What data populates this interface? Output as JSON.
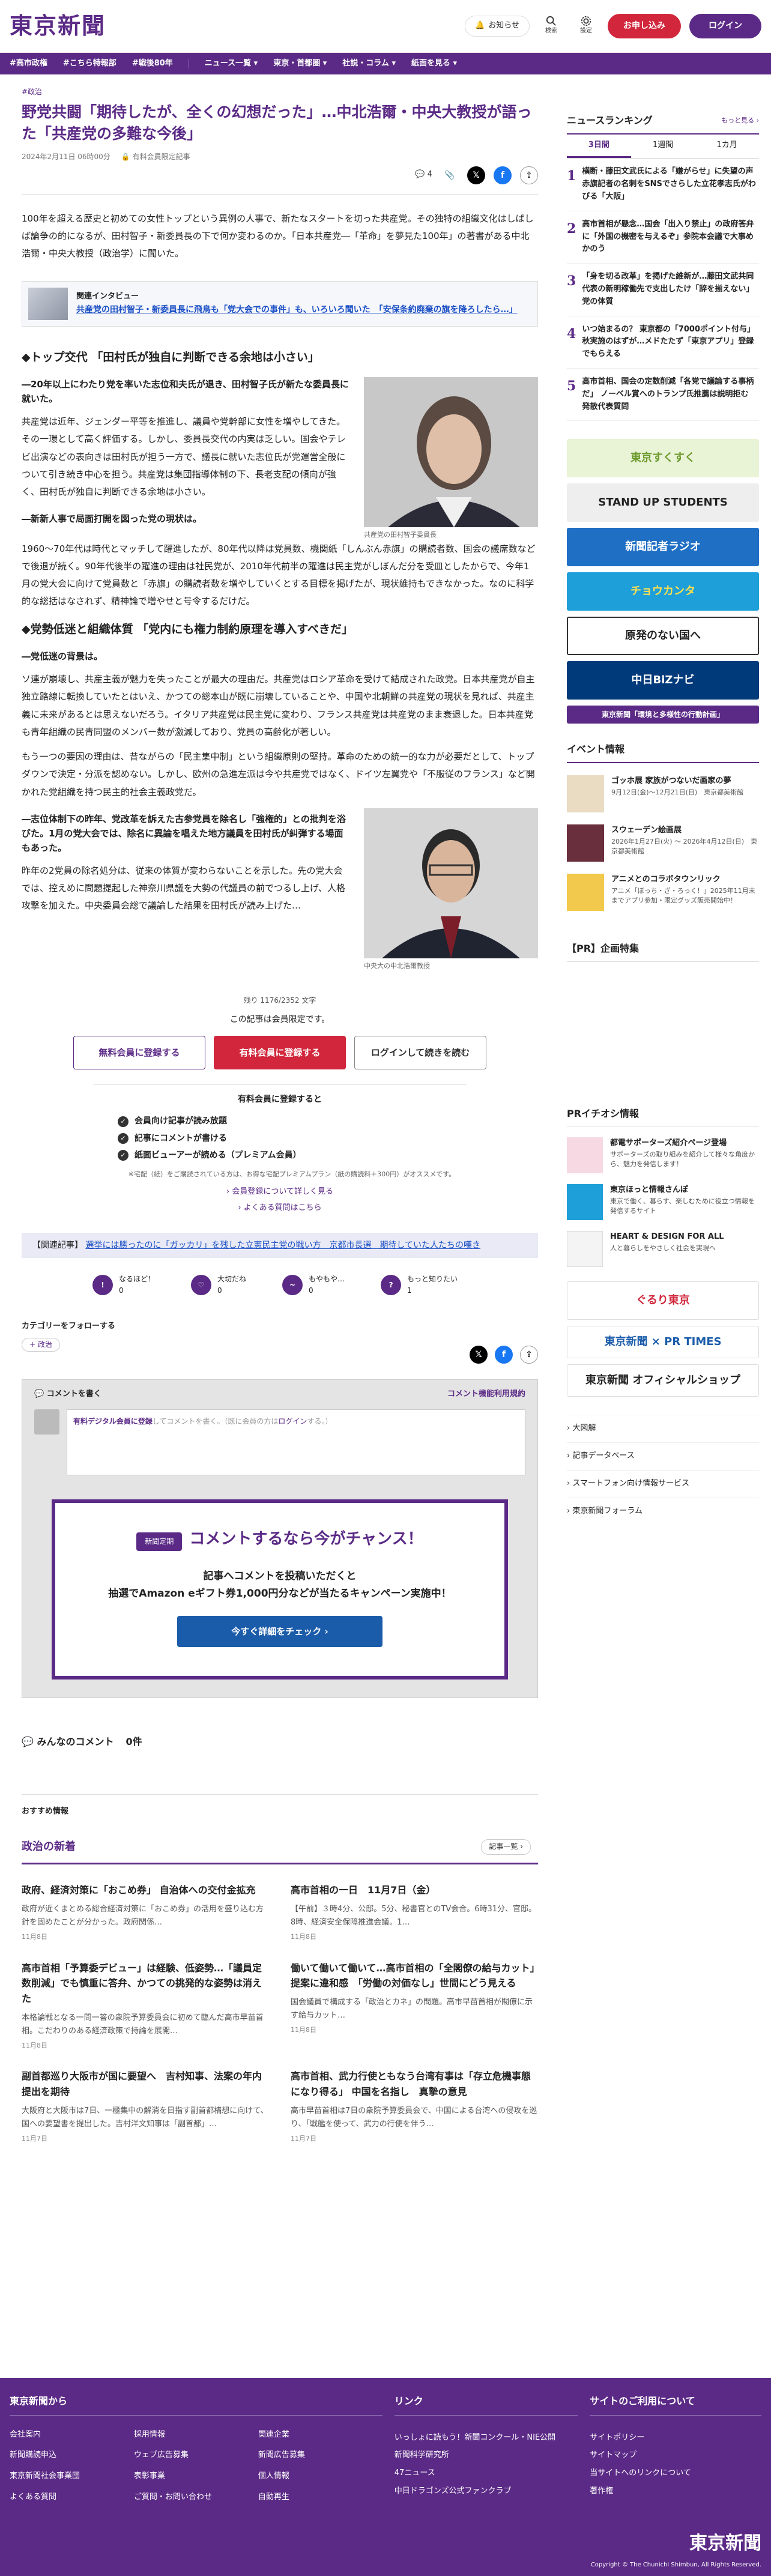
{
  "header": {
    "logo": "東京新聞",
    "notify_label": "お知らせ",
    "search_label": "検索",
    "settings_label": "設定",
    "signup_label": "お申し込み",
    "login_label": "ログイン"
  },
  "nav": [
    "#高市政権",
    "#こちら特報部",
    "#戦後80年",
    "ニュース一覧",
    "東京・首都圏",
    "社説・コラム",
    "紙面を見る"
  ],
  "article": {
    "category": "#政治",
    "title": "野党共闘「期待したが、全くの幻想だった」…中北浩爾・中央大教授が語った「共産党の多難な今後」",
    "date": "2024年2月11日 06時00分",
    "members_badge": "有料会員限定記事",
    "share_count": "4",
    "lead": "100年を超える歴史と初めての女性トップという異例の人事で、新たなスタートを切った共産党。その独特の組織文化はしばしば論争の的になるが、田村智子・新委員長の下で何か変わるのか。「日本共産党―「革命」を夢見た100年」の著書がある中北浩爾・中央大教授（政治学）に聞いた。",
    "related_label": "関連インタビュー",
    "related_link": "共産党の田村智子・新委員長に飛鳥も「党大会での事件」も、いろいろ聞いた　「安保条約廃棄の旗を降ろしたら…」",
    "sec1_title": "◆トップ交代 「田村氏が独自に判断できる余地は小さい」",
    "q1": "―20年以上にわたり党を率いた志位和夫氏が退き、田村智子氏が新たな委員長に就いた。",
    "p1": "共産党は近年、ジェンダー平等を推進し、議員や党幹部に女性を増やしてきた。その一環として高く評価する。しかし、委員長交代の内実は乏しい。国会やテレビ出演などの表向きは田村氏が担う一方で、議長に就いた志位氏が党運営全般について引き続き中心を担う。共産党は集団指導体制の下、長老支配の傾向が強く、田村氏が独自に判断できる余地は小さい。",
    "photo1_caption": "共産党の田村智子委員長",
    "q2": "―新新人事で局面打開を図った党の現状は。",
    "p2": "1960〜70年代は時代とマッチして躍進したが、80年代以降は党員数、機関紙「しんぶん赤旗」の購読者数、国会の議席数などで後退が続く。90年代後半の躍進の理由は社民党が、2010年代前半の躍進は民主党がしぼんだ分を受皿としたからで、今年1月の党大会に向けて党員数と「赤旗」の購読者数を増やしていくとする目標を掲げたが、現状維持もできなかった。なのに科学的な総括はなされず、精神論で増やせと号令するだけだ。",
    "sec2_title": "◆党勢低迷と組織体質 「党内にも権力制約原理を導入すべきだ」",
    "q3": "―党低迷の背景は。",
    "p3": "ソ連が崩壊し、共産主義が魅力を失ったことが最大の理由だ。共産党はロシア革命を受けて結成された政党。日本共産党が自主独立路線に転換していたとはいえ、かつての総本山が既に崩壊していることや、中国や北朝鮮の共産党の現状を見れば、共産主義に未来があるとは思えないだろう。イタリア共産党は民主党に変わり、フランス共産党は共産党のまま衰退した。日本共産党も青年組織の民青同盟のメンバー数が激減しており、党員の高齢化が著しい。",
    "p4": "もう一つの要因の理由は、昔ながらの「民主集中制」という組織原則の堅持。革命のための統一的な力が必要だとして、トップダウンで決定・分派を認めない。しかし、欧州の急進左派は今や共産党ではなく、ドイツ左翼党や「不服従のフランス」など開かれた党組織を持つ民主的社会主義政党だ。",
    "q4": "―志位体制下の昨年、党改革を訴えた古参党員を除名し「強権的」との批判を浴びた。1月の党大会では、除名に異論を唱えた地方議員を田村氏が糾弾する場面もあった。",
    "p5": "昨年の2党員の除名処分は、従来の体質が変わらないことを示した。先の党大会では、控えめに問題提起した神奈川県議を大勢の代議員の前でつるし上げ、人格攻撃を加えた。中央委員会総で議論した結果を田村氏が読み上げた…",
    "photo2_caption": "中央大の中北浩爾教授"
  },
  "paywall": {
    "remaining": "残り 1176/2352 文字",
    "message": "この記事は会員限定です。",
    "free_btn": "無料会員に登録する",
    "paid_btn": "有料会員に登録する",
    "login_btn": "ログインして続きを読む",
    "benefit_head": "有料会員に登録すると",
    "benefits": [
      "会員向け記事が読み放題",
      "記事にコメントが書ける",
      "紙面ビューアーが読める（プレミアム会員）"
    ],
    "note": "※宅配（紙）をご購読されている方は、お得な宅配プレミアムプラン（紙の購読料＋300円）がオススメです。",
    "link1": "会員登録について詳しく見る",
    "link2": "よくある質問はこちら"
  },
  "related_bar": {
    "label": "【関連記事】",
    "link": "選挙には勝ったのに「ガッカリ」を残した立憲民主党の戦い方　京都市長選　期待していた人たちの嘆き"
  },
  "reactions": [
    {
      "label": "なるほど！",
      "count": "0"
    },
    {
      "label": "大切だね",
      "count": "0"
    },
    {
      "label": "もやもや…",
      "count": "0"
    },
    {
      "label": "もっと知りたい",
      "count": "1"
    }
  ],
  "follow": {
    "label": "カテゴリーをフォローする",
    "tag": "政治"
  },
  "comment": {
    "head": "コメントを書く",
    "policy": "コメント機能利用規約",
    "login_prompt_pre": "有料デジタル会員に登録",
    "login_prompt_mid": "してコメントを書く。（既に会員の方は",
    "login_prompt_login": "ログイン",
    "login_prompt_post": "する。）"
  },
  "promo": {
    "tag": "新聞定期",
    "title": "コメントするなら今がチャンス！",
    "body1": "記事へコメントを投稿いただくと",
    "body2": "抽選でAmazon eギフト券1,000円分などが当たるキャンペーン実施中！",
    "btn": "今すぐ詳細をチェック"
  },
  "comments_count": {
    "label": "みんなのコメント",
    "count": "0件"
  },
  "recommend_label": "おすすめ情報",
  "politics_news": {
    "title": "政治の新着",
    "more": "記事一覧",
    "items": [
      {
        "title": "政府、経済対策に「おこめ券」 自治体への交付金拡充",
        "summary": "政府が近くまとめる総合経済対策に「おこめ券」の活用を盛り込む方針を固めたことが分かった。政府関係…",
        "date": "11月8日"
      },
      {
        "title": "高市首相の一日　11月7日（金）",
        "summary": "【午前】３時4分、公邸。5分、秘書官とのTV会合。6時31分、官邸。8時、経済安全保障推進会議。1…",
        "date": "11月8日"
      },
      {
        "title": "高市首相「予算委デビュー」は経験、低姿勢…「議員定数削減」でも慎重に答弁、かつての挑発的な姿勢は消えた",
        "summary": "本格論戦となる一問一答の衆院予算委員会に初めて臨んだ高市早苗首相。こだわりのある経済政策で持論を展開…",
        "date": "11月8日"
      },
      {
        "title": "働いて働いて働いて…高市首相の「全閣僚の給与カット」提案に違和感　「労働の対価なし」世間にどう見える",
        "summary": "国会議員で構成する「政治とカネ」の問題。高市早苗首相が閣僚に示す給与カット…",
        "date": "11月8日"
      },
      {
        "title": "副首都巡り大阪市が国に要望へ　吉村知事、法案の年内提出を期待",
        "summary": "大阪府と大阪市は7日、一極集中の解消を目指す副首都構想に向けて、国への要望書を提出した。吉村洋文知事は「副首都」…",
        "date": "11月7日"
      },
      {
        "title": "高市首相、武力行使ともなう台湾有事は「存立危機事態になり得る」 中国を名指し　真摯の意見",
        "summary": "高市早苗首相は7日の衆院予算委員会で、中国による台湾への侵攻を巡り、「戦艦を使って、武力の行使を伴う…",
        "date": "11月7日"
      }
    ]
  },
  "sidebar": {
    "ranking_title": "ニュースランキング",
    "ranking_more": "もっと見る",
    "tabs": [
      "3日間",
      "1週間",
      "1カ月"
    ],
    "ranking": [
      {
        "n": "1",
        "t": "横断・藤田文武氏による「嫌がらせ」に失望の声　赤旗記者の名刺をSNSでさらした立花孝志氏がわびる「大阪」"
      },
      {
        "n": "2",
        "t": "高市首相が懸念…国会「出入り禁止」の政府答弁に「外国の機密を与えるぞ」参院本会議で大事めかのう"
      },
      {
        "n": "3",
        "t": "「身を切る改革」を掲げた維新が…藤田文武共同代表の新明稼働先で支出したけ「辞を揃えない」党の体質"
      },
      {
        "n": "4",
        "t": "いつ始まるの？ 東京都の「7000ポイント付与」 秋実施のはずが…メドたたず「東京アプリ」登録でもらえる"
      },
      {
        "n": "5",
        "t": "高市首相、国会の定数削減「各党で議論する事柄だ」 ノーベル賞へのトランプ氏推薦は説明拒む　発散代表質問"
      }
    ],
    "banners": [
      "東京すくすく",
      "STAND UP STUDENTS",
      "新聞記者ラジオ",
      "チョウカンタ",
      "原発のない国へ",
      "中日BiZナビ",
      "東京新聞「環境と多様性の行動計画」"
    ],
    "events_title": "イベント情報",
    "events": [
      {
        "t": "ゴッホ展 家族がつないだ画家の夢",
        "s": "9月12日(金)〜12月21日(日)　東京都美術館"
      },
      {
        "t": "スウェーデン絵画展",
        "s": "2026年1月27日(火) 〜 2026年4月12日(日)　東京都美術館"
      },
      {
        "t": "アニメとのコラボタウンリック",
        "s": "アニメ「ぼっち・ざ・ろっく！」2025年11月末までアプリ参加・限定グッズ販売開始中！"
      }
    ],
    "pr_title": "【PR】企画特集",
    "pr2_title": "PRイチオシ情報",
    "pr2": [
      {
        "t": "都電サポーターズ紹介ページ登場",
        "s": "サポーターズの取り組みを紹介して様々な角度から、魅力を発信します！"
      },
      {
        "t": "東京ほっと情報さんぽ",
        "s": "東京で働く、暮らす、楽しむために役立つ情報を発信するサイト"
      },
      {
        "t": "HEART & DESIGN FOR ALL",
        "s": "人と暮らしをやさしく社会を実現へ"
      }
    ],
    "banners2": [
      "ぐるり東京",
      "東京新聞 × PR TIMES",
      "東京新聞 オフィシャルショップ"
    ],
    "links": [
      "大図解",
      "記事データベース",
      "スマートフォン向け情報サービス",
      "東京新聞フォーラム"
    ]
  },
  "footer": {
    "col1_title": "東京新聞から",
    "col1_links": [
      "会社案内",
      "採用情報",
      "関連企業",
      "新聞購読申込",
      "ウェブ広告募集",
      "新聞広告募集",
      "東京新聞社会事業団",
      "表彰事業",
      "個人情報",
      "よくある質問",
      "ご質問・お問い合わせ",
      "自動再生"
    ],
    "col2_title": "リンク",
    "col2_links": [
      "いっしょに読もう！新聞コンクール・NIE公開",
      "新聞科学研究所",
      "47ニュース",
      "中日ドラゴンズ公式ファンクラブ"
    ],
    "col3_title": "サイトのご利用について",
    "col3_links": [
      "サイトポリシー",
      "サイトマップ",
      "当サイトへのリンクについて",
      "著作権"
    ],
    "logo": "東京新聞",
    "copyright": "Copyright © The Chunichi Shimbun, All Rights Reserved."
  }
}
